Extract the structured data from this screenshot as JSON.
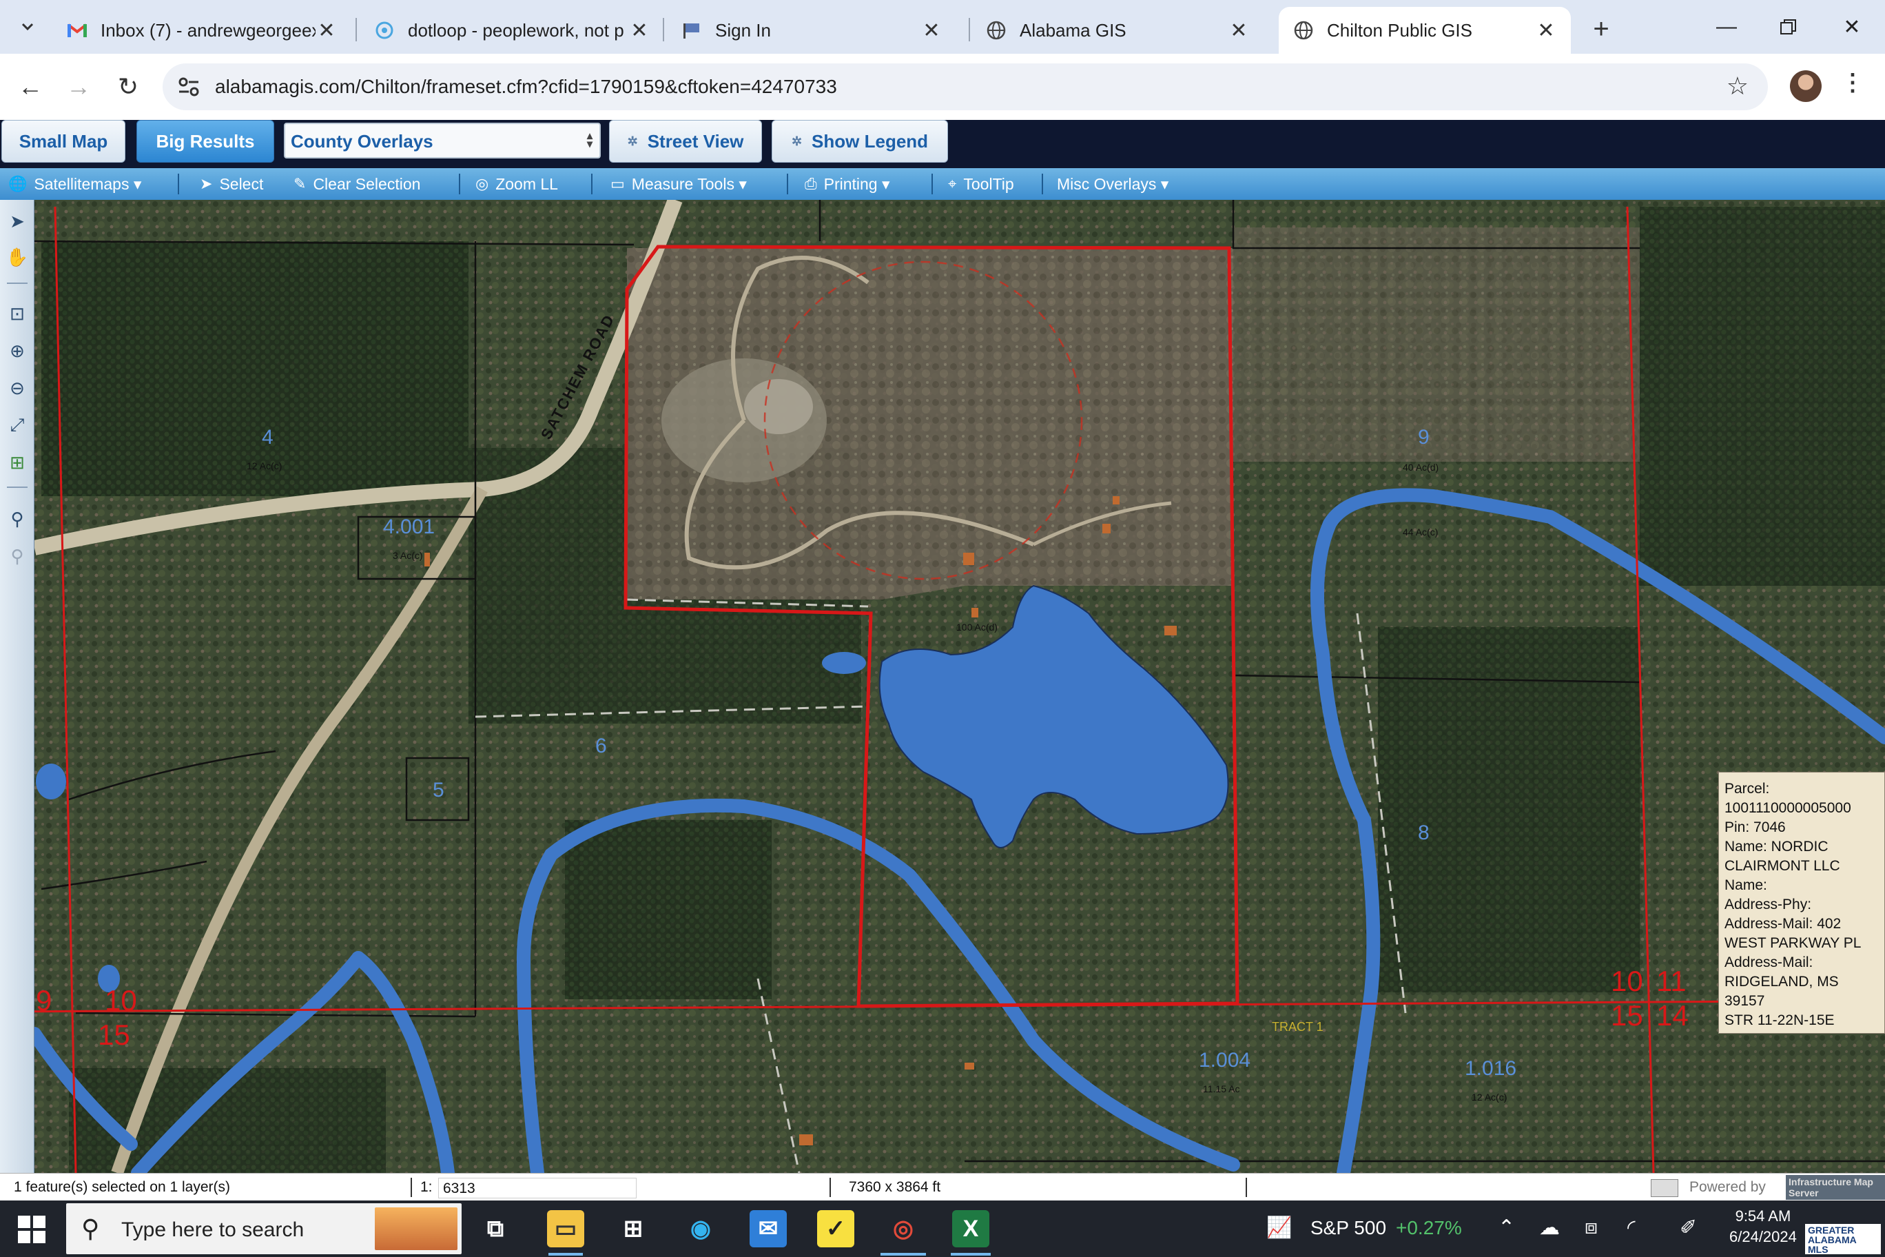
{
  "browser": {
    "tabs": [
      {
        "title": "Inbox (7) - andrewgeorgeexi",
        "icon": "gmail-icon"
      },
      {
        "title": "dotloop - peoplework, not p",
        "icon": "dotloop-icon"
      },
      {
        "title": "Sign In",
        "icon": "flag-icon"
      },
      {
        "title": "Alabama GIS",
        "icon": "globe-icon"
      },
      {
        "title": "Chilton Public GIS",
        "icon": "globe-icon",
        "active": true
      }
    ],
    "new_tab": "+",
    "url": "alabamagis.com/Chilton/frameset.cfm?cfid=1790159&cftoken=42470733"
  },
  "gis": {
    "buttons": {
      "small_map": "Small Map",
      "big_results": "Big Results",
      "street_view": "Street View",
      "show_legend": "Show Legend"
    },
    "overlays_select": "County Overlays",
    "menu": {
      "satellitemaps": "Satellitemaps",
      "select": "Select",
      "clear_selection": "Clear Selection",
      "zoom_ll": "Zoom LL",
      "measure_tools": "Measure Tools",
      "printing": "Printing",
      "tooltip": "ToolTip",
      "misc_overlays": "Misc Overlays"
    },
    "map_labels": {
      "road": "SATCHEM ROAD",
      "p4": "4",
      "p4_ac": "12 Ac(c)",
      "p4001": "4.001",
      "p4001_ac": "3 Ac(c)",
      "p5": "5",
      "p6": "6",
      "p7_ac": "100 Ac(d)",
      "p9": "9",
      "p9_ac": "40 Ac(d)",
      "p44_ac": "44 Ac(c)",
      "p8": "8",
      "p1004": "1.004",
      "p1004_ac": "11.15 Ac",
      "p1016": "1.016",
      "p1016_ac": "12 Ac(c)",
      "tract": "TRACT 1",
      "sec9": "9",
      "sec10a": "10",
      "sec15a": "15",
      "sec10b": "10",
      "sec11": "11",
      "sec15b": "15",
      "sec14": "14"
    },
    "parcel_info": [
      "Parcel:",
      "1001110000005000",
      "Pin: 7046",
      "Name: NORDIC",
      "CLAIRMONT LLC",
      "Name:",
      "Address-Phy:",
      "Address-Mail: 402",
      "WEST PARKWAY PL",
      "Address-Mail:",
      "RIDGELAND, MS",
      "39157",
      "STR 11-22N-15E"
    ],
    "status": {
      "selection": "1 feature(s) selected on 1 layer(s)",
      "scale_prefix": "1:",
      "scale": "6313",
      "extent": "7360 x 3864 ft",
      "powered_by": "Powered by",
      "powered_brand": "Infrastructure Map Server"
    }
  },
  "taskbar": {
    "search_placeholder": "Type here to search",
    "stock_name": "S&P 500",
    "stock_change": "+0.27%",
    "time": "9:54 AM",
    "date": "6/24/2024",
    "watermark": "GREATER ALABAMA MLS"
  },
  "colors": {
    "parcel_outline": "#d81818",
    "water": "#3f78c8",
    "menu_bar": "#4a98d6",
    "stock_up": "#53c26b"
  }
}
